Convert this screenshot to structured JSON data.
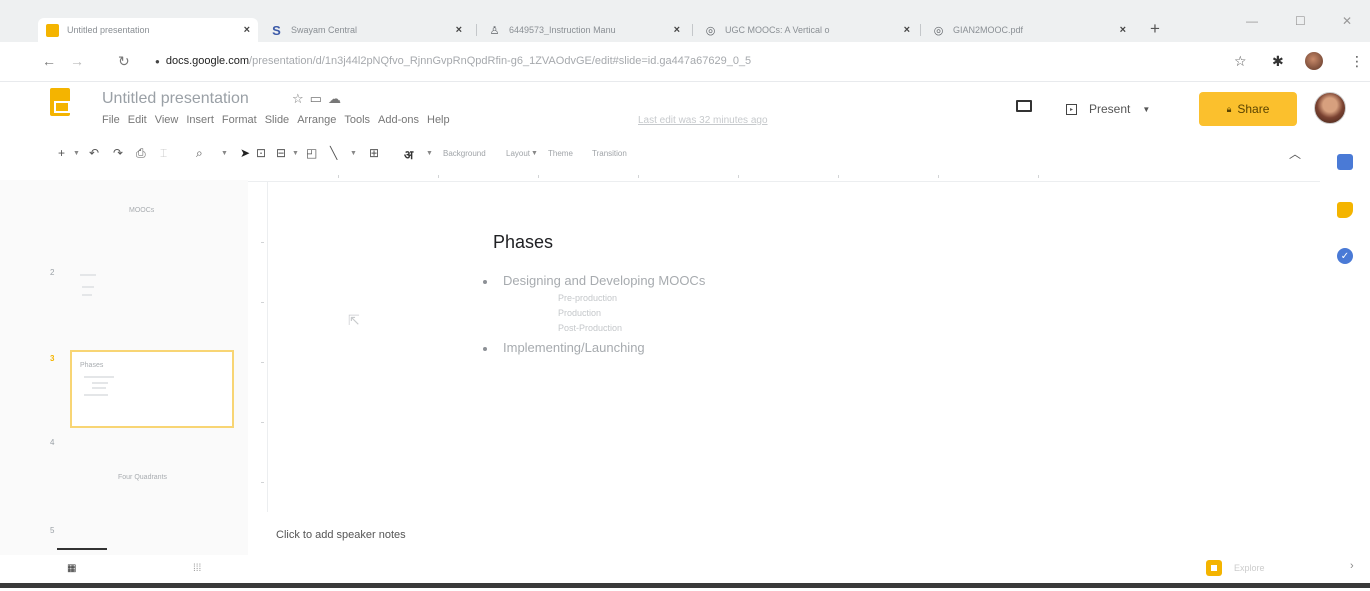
{
  "browser": {
    "tabs": [
      {
        "title": "Untitled presentation",
        "favicon": "slides-icon",
        "active": true
      },
      {
        "title": "Swayam Central",
        "favicon": "swayam-icon",
        "active": false
      },
      {
        "title": "6449573_Instruction Manu",
        "favicon": "user-icon",
        "active": false
      },
      {
        "title": "UGC MOOCs: A Vertical o",
        "favicon": "globe-icon",
        "active": false
      },
      {
        "title": "GIAN2MOOC.pdf",
        "favicon": "globe-icon",
        "active": false
      }
    ],
    "new_tab": "+",
    "url_host": "docs.google.com",
    "url_path": "/presentation/d/1n3j44l2pNQfvo_RjnnGvpRnQpdRfin-g6_1ZVAOdvGE/edit#slide=id.ga447a67629_0_5"
  },
  "docs": {
    "title": "Untitled presentation",
    "menu": [
      "File",
      "Edit",
      "View",
      "Insert",
      "Format",
      "Slide",
      "Arrange",
      "Tools",
      "Add-ons",
      "Help"
    ],
    "last_edit": "Last edit was 32 minutes ago",
    "present_label": "Present",
    "share_label": "Share"
  },
  "toolbar": {
    "background": "Background",
    "layout": "Layout",
    "theme": "Theme",
    "transition": "Transition",
    "hindi_glyph": "अ"
  },
  "filmstrip": {
    "slide1_label": "MOOCs",
    "slide2_num": "2",
    "slide3_num": "3",
    "slide4_num": "4",
    "slide4_label": "Four Quadrants",
    "slide5_num": "5",
    "slide3_title": "Phases"
  },
  "slide": {
    "title": "Phases",
    "bullets": [
      {
        "text": "Designing and Developing MOOCs",
        "sub": [
          "Pre-production",
          "Production",
          "Post-Production"
        ]
      },
      {
        "text": "Implementing/Launching",
        "sub": []
      }
    ]
  },
  "notes": {
    "placeholder": "Click to add speaker notes"
  },
  "explore": {
    "label": "Explore"
  },
  "colors": {
    "accent": "#f4b400",
    "share": "#fbc02d",
    "sidebar_blue": "#4a7ad6"
  }
}
